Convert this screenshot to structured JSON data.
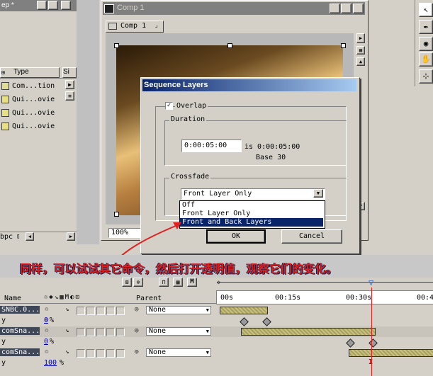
{
  "project": {
    "title_fragment": "ep *",
    "columns": {
      "type": "Type",
      "size": "Si"
    },
    "rows": [
      {
        "name_fragment": "",
        "type": "Com...tion"
      },
      {
        "name_fragment": "",
        "type": "Qui...ovie"
      },
      {
        "name_fragment": "",
        "type": "Qui...ovie"
      },
      {
        "name_fragment": "",
        "type": "Qui...ovie"
      }
    ],
    "bpc": "bpc"
  },
  "comp_window": {
    "title": "Comp 1",
    "tab": "Comp 1",
    "zoom": "100%"
  },
  "dialog": {
    "title": "Sequence Layers",
    "overlap_label": "Overlap",
    "overlap_checked": true,
    "duration_group": "Duration",
    "duration_value": "0:00:05:00",
    "is_text": "is 0:00:05:00",
    "base_text": "Base 30",
    "crossfade_group": "Crossfade",
    "crossfade_selected": "Front Layer Only",
    "options": [
      "Off",
      "Front Layer Only",
      "Front and Back Layers"
    ],
    "highlighted_option": "Front and Back Layers",
    "ok": "OK",
    "cancel": "Cancel"
  },
  "annotation": "同样，可以试试其它命令，然后打开透明值，观察它们的变化。",
  "timeline": {
    "name_header": "Name",
    "parent_header": "Parent",
    "ticks": [
      "00s",
      "00:15s",
      "00:30s",
      "00:4"
    ],
    "layers": [
      {
        "name": "SNBC.0...",
        "parent": "None"
      },
      {
        "prop": "y",
        "value": "0",
        "unit": "%"
      },
      {
        "name": "comSna...",
        "parent": "None"
      },
      {
        "prop": "y",
        "value": "0",
        "unit": "%"
      },
      {
        "name": "comSna...",
        "parent": "None"
      },
      {
        "prop": "y",
        "value": "100",
        "unit": "%"
      }
    ],
    "current_time_marker": "I"
  },
  "colors": {
    "win_bg": "#d4d0c8",
    "title_active": "#0a246a",
    "annotation_red": "#e02020",
    "annotation_bg": "#10204a",
    "bar_fill": "#b8b070"
  }
}
